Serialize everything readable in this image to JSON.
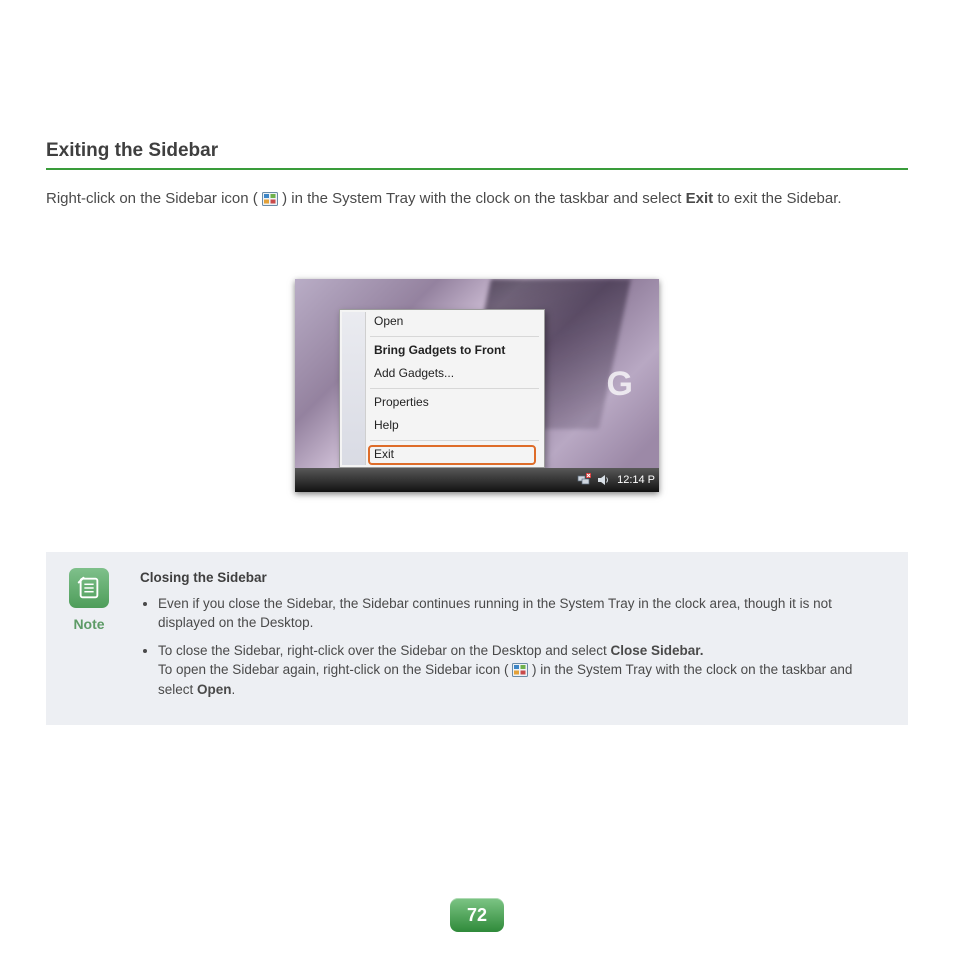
{
  "section_title": "Exiting the Sidebar",
  "intro": {
    "part1": "Right-click on the Sidebar icon (",
    "part2": ") in the System Tray with the clock on the taskbar and select ",
    "bold": "Exit",
    "part3": " to exit the Sidebar."
  },
  "screenshot": {
    "brand_letter": "G",
    "menu": {
      "open": "Open",
      "bring_front": "Bring Gadgets to Front",
      "add_gadgets": "Add Gadgets...",
      "properties": "Properties",
      "help": "Help",
      "exit": "Exit"
    },
    "taskbar_time": "12:14 P"
  },
  "note": {
    "label": "Note",
    "title": "Closing the Sidebar",
    "bullet1": "Even if you close the Sidebar, the Sidebar continues running in the System Tray in the clock area, though it is not displayed on the Desktop.",
    "bullet2": {
      "pre": "To close the Sidebar, right-click over the Sidebar on the Desktop and select ",
      "bold1": "Close Sidebar.",
      "line2a": "To open the Sidebar again, right-click on the Sidebar icon (",
      "line2b": ") in the System Tray with the clock on the taskbar and select ",
      "bold2": "Open",
      "line2c": "."
    }
  },
  "page_number": "72"
}
